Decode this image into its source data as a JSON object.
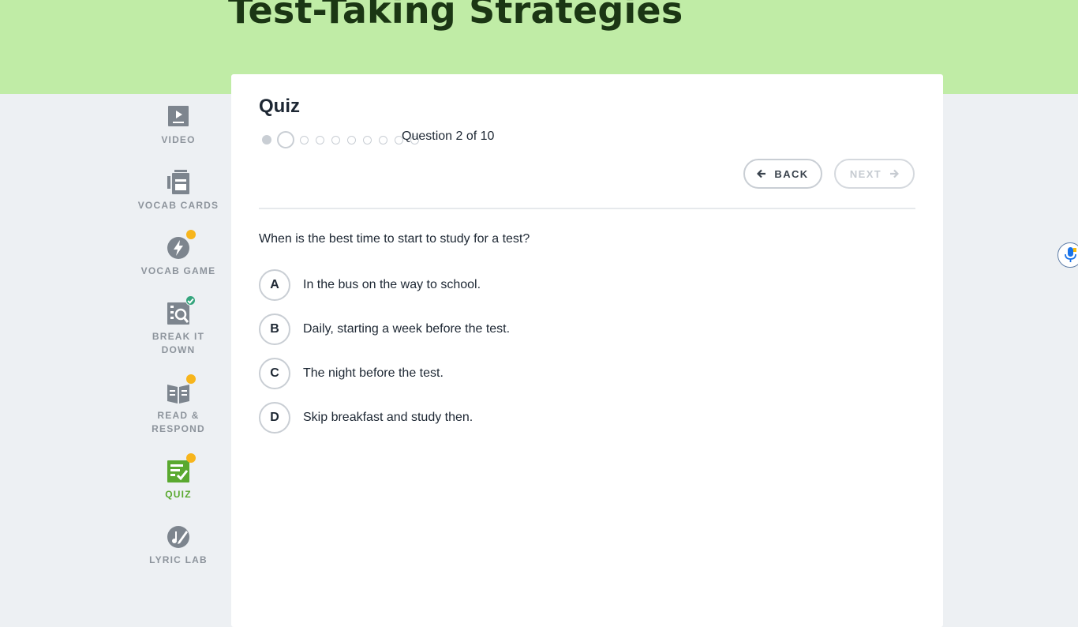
{
  "lesson": {
    "title": "Test-Taking Strategies"
  },
  "sidebar": {
    "items": [
      {
        "label": "VIDEO",
        "icon": "video-icon",
        "badge": "none",
        "active": false
      },
      {
        "label": "VOCAB CARDS",
        "icon": "vocab-cards-icon",
        "badge": "none",
        "active": false
      },
      {
        "label": "VOCAB GAME",
        "icon": "lightning-icon",
        "badge": "incomplete",
        "active": false
      },
      {
        "label": "BREAK IT DOWN",
        "icon": "magnifier-icon",
        "badge": "complete",
        "active": false
      },
      {
        "label": "READ & RESPOND",
        "icon": "book-icon",
        "badge": "incomplete",
        "active": false
      },
      {
        "label": "QUIZ",
        "icon": "checklist-icon",
        "badge": "incomplete",
        "active": true
      },
      {
        "label": "LYRIC LAB",
        "icon": "pencil-icon",
        "badge": "none",
        "active": false
      }
    ]
  },
  "quiz": {
    "title": "Quiz",
    "progress": {
      "current": 2,
      "total": 10,
      "text": "Question 2 of 10"
    },
    "back_label": "BACK",
    "next_label": "NEXT",
    "question": "When is the best time to start to study for a test?",
    "options": [
      {
        "letter": "A",
        "text": "In the bus on the way to school."
      },
      {
        "letter": "B",
        "text": "Daily, starting a week before the test."
      },
      {
        "letter": "C",
        "text": "The night before the test."
      },
      {
        "letter": "D",
        "text": "Skip breakfast and study then."
      }
    ]
  },
  "colors": {
    "hero": "#c0eca6",
    "active": "#5aa92f",
    "badge_incomplete": "#f7b51c",
    "badge_complete": "#35a57d"
  },
  "widgets": {
    "voice_input": "microphone-icon"
  }
}
